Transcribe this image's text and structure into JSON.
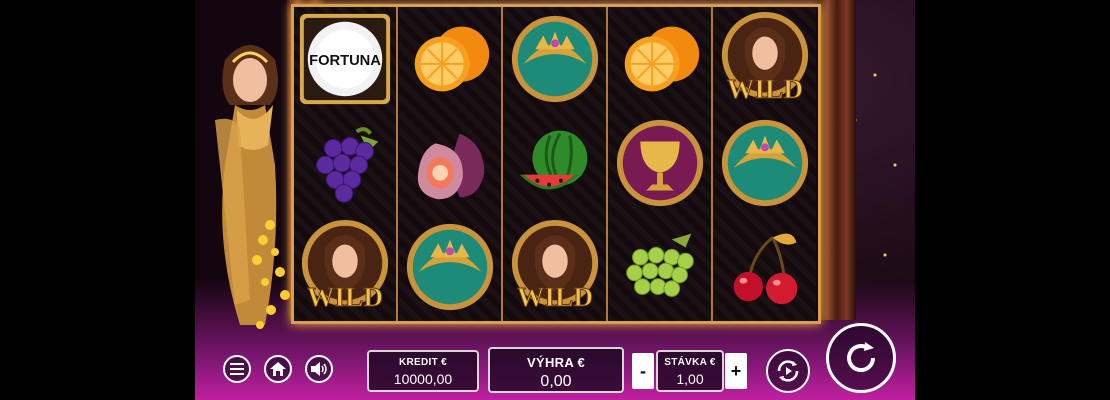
{
  "game": {
    "symbols": {
      "logo_text": "FORTUNA",
      "wild_text": "WILD"
    },
    "grid": [
      [
        "fortuna-logo",
        "grape",
        "wild"
      ],
      [
        "orange",
        "fig",
        "tiara"
      ],
      [
        "tiara",
        "watermelon",
        "wild"
      ],
      [
        "orange",
        "golden-chalice",
        "green-grapes"
      ],
      [
        "wild",
        "tiara",
        "cherry"
      ]
    ]
  },
  "controls": {
    "kredit_label": "KREDIT €",
    "kredit_value": "10000,00",
    "vyhra_label": "VÝHRA €",
    "vyhra_value": "0,00",
    "stavka_label": "STÁVKA €",
    "stavka_value": "1,00",
    "minus": "-",
    "plus": "+"
  },
  "icons": [
    "menu-icon",
    "home-icon",
    "sound-icon",
    "autoplay-icon",
    "spin-icon"
  ],
  "colors": {
    "gold": "#d8a04a",
    "magenta": "#c0209f"
  }
}
